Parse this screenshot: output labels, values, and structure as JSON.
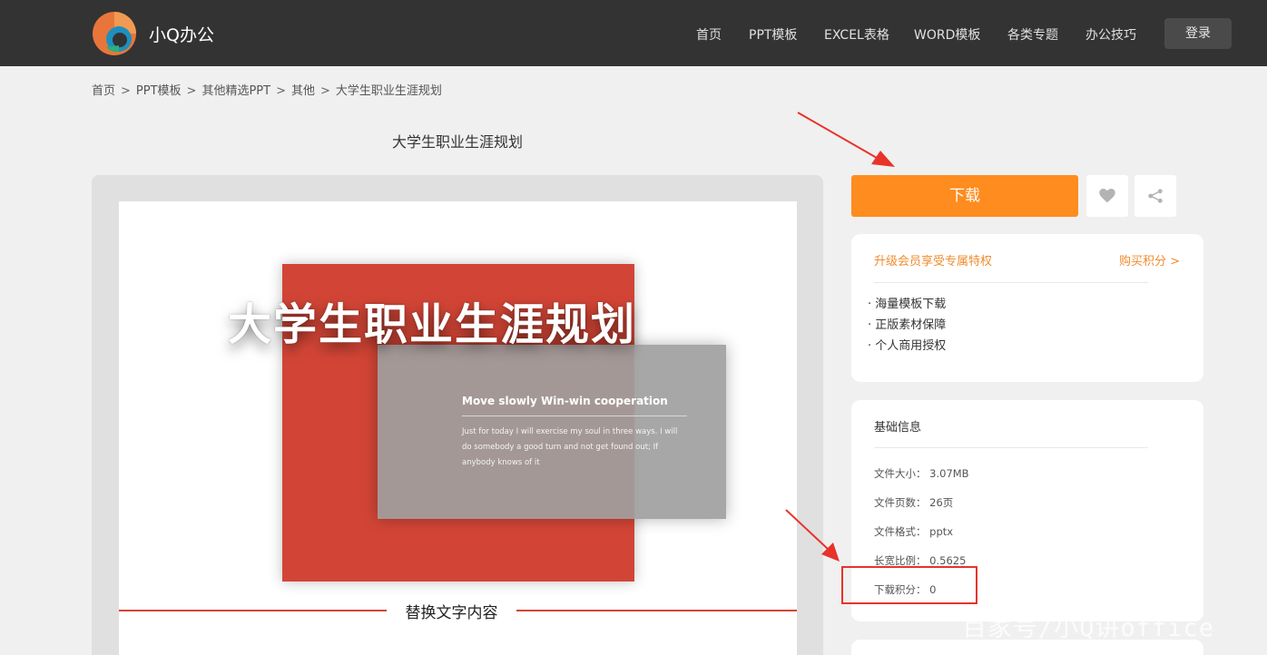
{
  "header": {
    "brand": "小Q办公",
    "nav": [
      {
        "label": "首页"
      },
      {
        "label": "PPT模板"
      },
      {
        "label": "EXCEL表格"
      },
      {
        "label": "WORD模板"
      },
      {
        "label": "各类专题"
      },
      {
        "label": "办公技巧"
      }
    ],
    "login_label": "登录"
  },
  "breadcrumb": [
    "首页",
    "PPT模板",
    "其他精选PPT",
    "其他",
    "大学生职业生涯规划"
  ],
  "breadcrumb_sep": ">",
  "page_title": "大学生职业生涯规划",
  "slide": {
    "big_title": "大学生职业生涯规划",
    "card_heading": "Move slowly Win-win cooperation",
    "card_body": "Just for today I will exercise my soul in three ways. I will do somebody a good turn and not get found out; If anybody knows of it",
    "subtitle": "替换文字内容"
  },
  "actions": {
    "download_label": "下载",
    "favorite_icon": "heart-icon",
    "share_icon": "share-icon"
  },
  "vip": {
    "title": "升级会员享受专属特权",
    "buy_label": "购买积分 >",
    "benefits": [
      "· 海量模板下载",
      "· 正版素材保障",
      "· 个人商用授权"
    ]
  },
  "info": {
    "title": "基础信息",
    "rows": [
      {
        "label": "文件大小：",
        "value": "3.07MB"
      },
      {
        "label": "文件页数：",
        "value": "26页"
      },
      {
        "label": "文件格式：",
        "value": "pptx"
      },
      {
        "label": "长宽比例：",
        "value": "0.5625"
      },
      {
        "label": "下载积分：",
        "value": "0"
      }
    ]
  },
  "watermark": "百家号/小Q讲office",
  "colors": {
    "header_bg": "#333333",
    "accent_orange": "#ff8c1e",
    "vip_orange": "#f08c2f",
    "slide_red": "#d24536",
    "annotation_red": "#e8332a"
  }
}
